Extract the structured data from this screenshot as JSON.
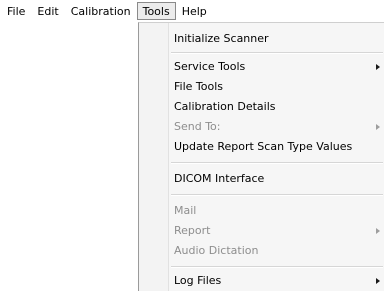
{
  "menubar": {
    "items": [
      {
        "label": "File"
      },
      {
        "label": "Edit"
      },
      {
        "label": "Calibration"
      },
      {
        "label": "Tools",
        "open": true
      },
      {
        "label": "Help"
      }
    ]
  },
  "tools_menu": {
    "initialize_scanner": "Initialize Scanner",
    "service_tools": "Service Tools",
    "file_tools": "File Tools",
    "calibration_details": "Calibration Details",
    "send_to": "Send To:",
    "update_report": "Update Report Scan Type Values",
    "dicom_interface": "DICOM Interface",
    "mail": "Mail",
    "report": "Report",
    "audio_dictation": "Audio Dictation",
    "log_files": "Log Files"
  },
  "icons": {
    "submenu": "chevron-right-icon"
  },
  "colors": {
    "menu_background": "#f6f6f6",
    "disabled_text": "#8e8e8e",
    "open_menu_highlight": "#ececec"
  }
}
